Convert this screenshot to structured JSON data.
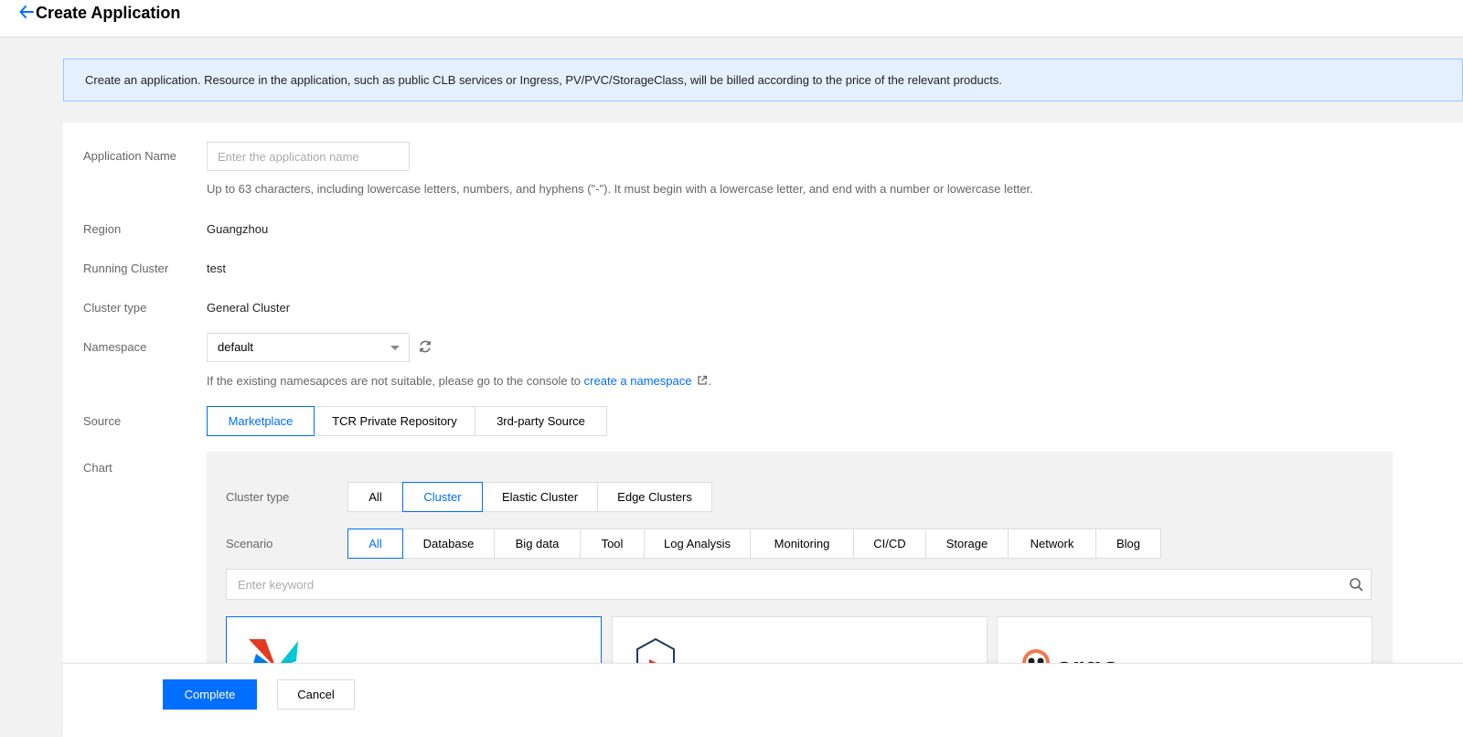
{
  "header": {
    "title": "Create Application",
    "back_icon": "arrow-left-icon"
  },
  "notice": {
    "text": "Create an application. Resource in the application, such as public CLB services or Ingress, PV/PVC/StorageClass, will be billed according to the price of the relevant products."
  },
  "form": {
    "app_name": {
      "label": "Application Name",
      "placeholder": "Enter the application name",
      "value": "",
      "hint": "Up to 63 characters, including lowercase letters, numbers, and hyphens (\"-\"). It must begin with a lowercase letter, and end with a number or lowercase letter."
    },
    "region": {
      "label": "Region",
      "value": "Guangzhou"
    },
    "running_cluster": {
      "label": "Running Cluster",
      "value": "test"
    },
    "cluster_type": {
      "label": "Cluster type",
      "value": "General Cluster"
    },
    "namespace": {
      "label": "Namespace",
      "selected": "default",
      "hint_prefix": "If the existing namesapces are not suitable, please go to the console to",
      "link": "create a namespace",
      "hint_suffix": "."
    },
    "source": {
      "label": "Source",
      "options": [
        "Marketplace",
        "TCR Private Repository",
        "3rd-party Source"
      ],
      "selected": "Marketplace"
    },
    "chart": {
      "label": "Chart",
      "cluster_type": {
        "label": "Cluster type",
        "options": [
          "All",
          "Cluster",
          "Elastic Cluster",
          "Edge Clusters"
        ],
        "selected": "Cluster"
      },
      "scenario": {
        "label": "Scenario",
        "options": [
          "All",
          "Database",
          "Big data",
          "Tool",
          "Log Analysis",
          "Monitoring",
          "CI/CD",
          "Storage",
          "Network",
          "Blog"
        ],
        "selected": "All"
      },
      "search": {
        "placeholder": "Enter keyword",
        "value": ""
      },
      "cards": [
        {
          "logo": "airflow-pinwheel-icon",
          "selected": true
        },
        {
          "logo": "hexagon-play-icon",
          "selected": false
        },
        {
          "logo": "argo-octopus-icon",
          "logo_text": "argo",
          "selected": false
        }
      ]
    }
  },
  "footer": {
    "complete_label": "Complete",
    "cancel_label": "Cancel"
  },
  "colors": {
    "accent": "#006eff",
    "notice_bg": "#e5f0ff",
    "notice_border": "#97c7ff",
    "page_bg": "#f2f2f2"
  }
}
